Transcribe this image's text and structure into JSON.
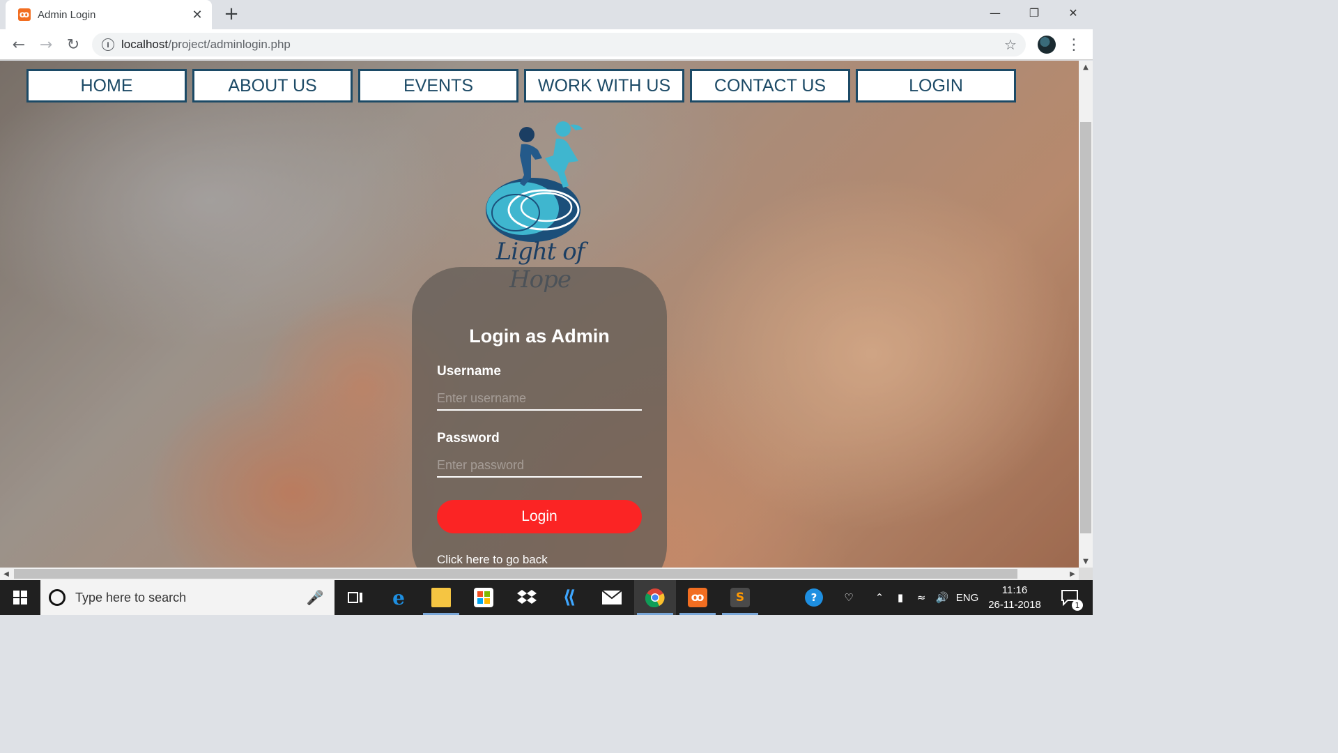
{
  "browser": {
    "tab_title": "Admin Login",
    "tab_close": "✕",
    "new_tab": "+",
    "url_host": "localhost",
    "url_path": "/project/adminlogin.php"
  },
  "nav": {
    "items": [
      {
        "label": "HOME"
      },
      {
        "label": "ABOUT US"
      },
      {
        "label": "EVENTS"
      },
      {
        "label": "WORK WITH US"
      },
      {
        "label": "CONTACT US"
      },
      {
        "label": "LOGIN"
      }
    ]
  },
  "logo": {
    "text": "Light of Hope",
    "colors": {
      "figure_dark": "#1b3e63",
      "figure_light": "#3fb6cf"
    }
  },
  "login": {
    "title": "Login as Admin",
    "username_label": "Username",
    "username_placeholder": "Enter username",
    "password_label": "Password",
    "password_placeholder": "Enter password",
    "button_label": "Login",
    "back_link": "Click here to go back",
    "button_color": "#fb2424"
  },
  "taskbar": {
    "search_placeholder": "Type here to search",
    "apps": [
      "task-view",
      "edge",
      "file-explorer",
      "store",
      "dropbox",
      "visual-studio",
      "mail",
      "chrome",
      "xampp",
      "sublime-text"
    ],
    "language": "ENG",
    "time": "11:16",
    "date": "26-11-2018",
    "notification_count": "1"
  },
  "colors": {
    "nav_text": "#1c4a66",
    "nav_border": "#1c4a66"
  }
}
